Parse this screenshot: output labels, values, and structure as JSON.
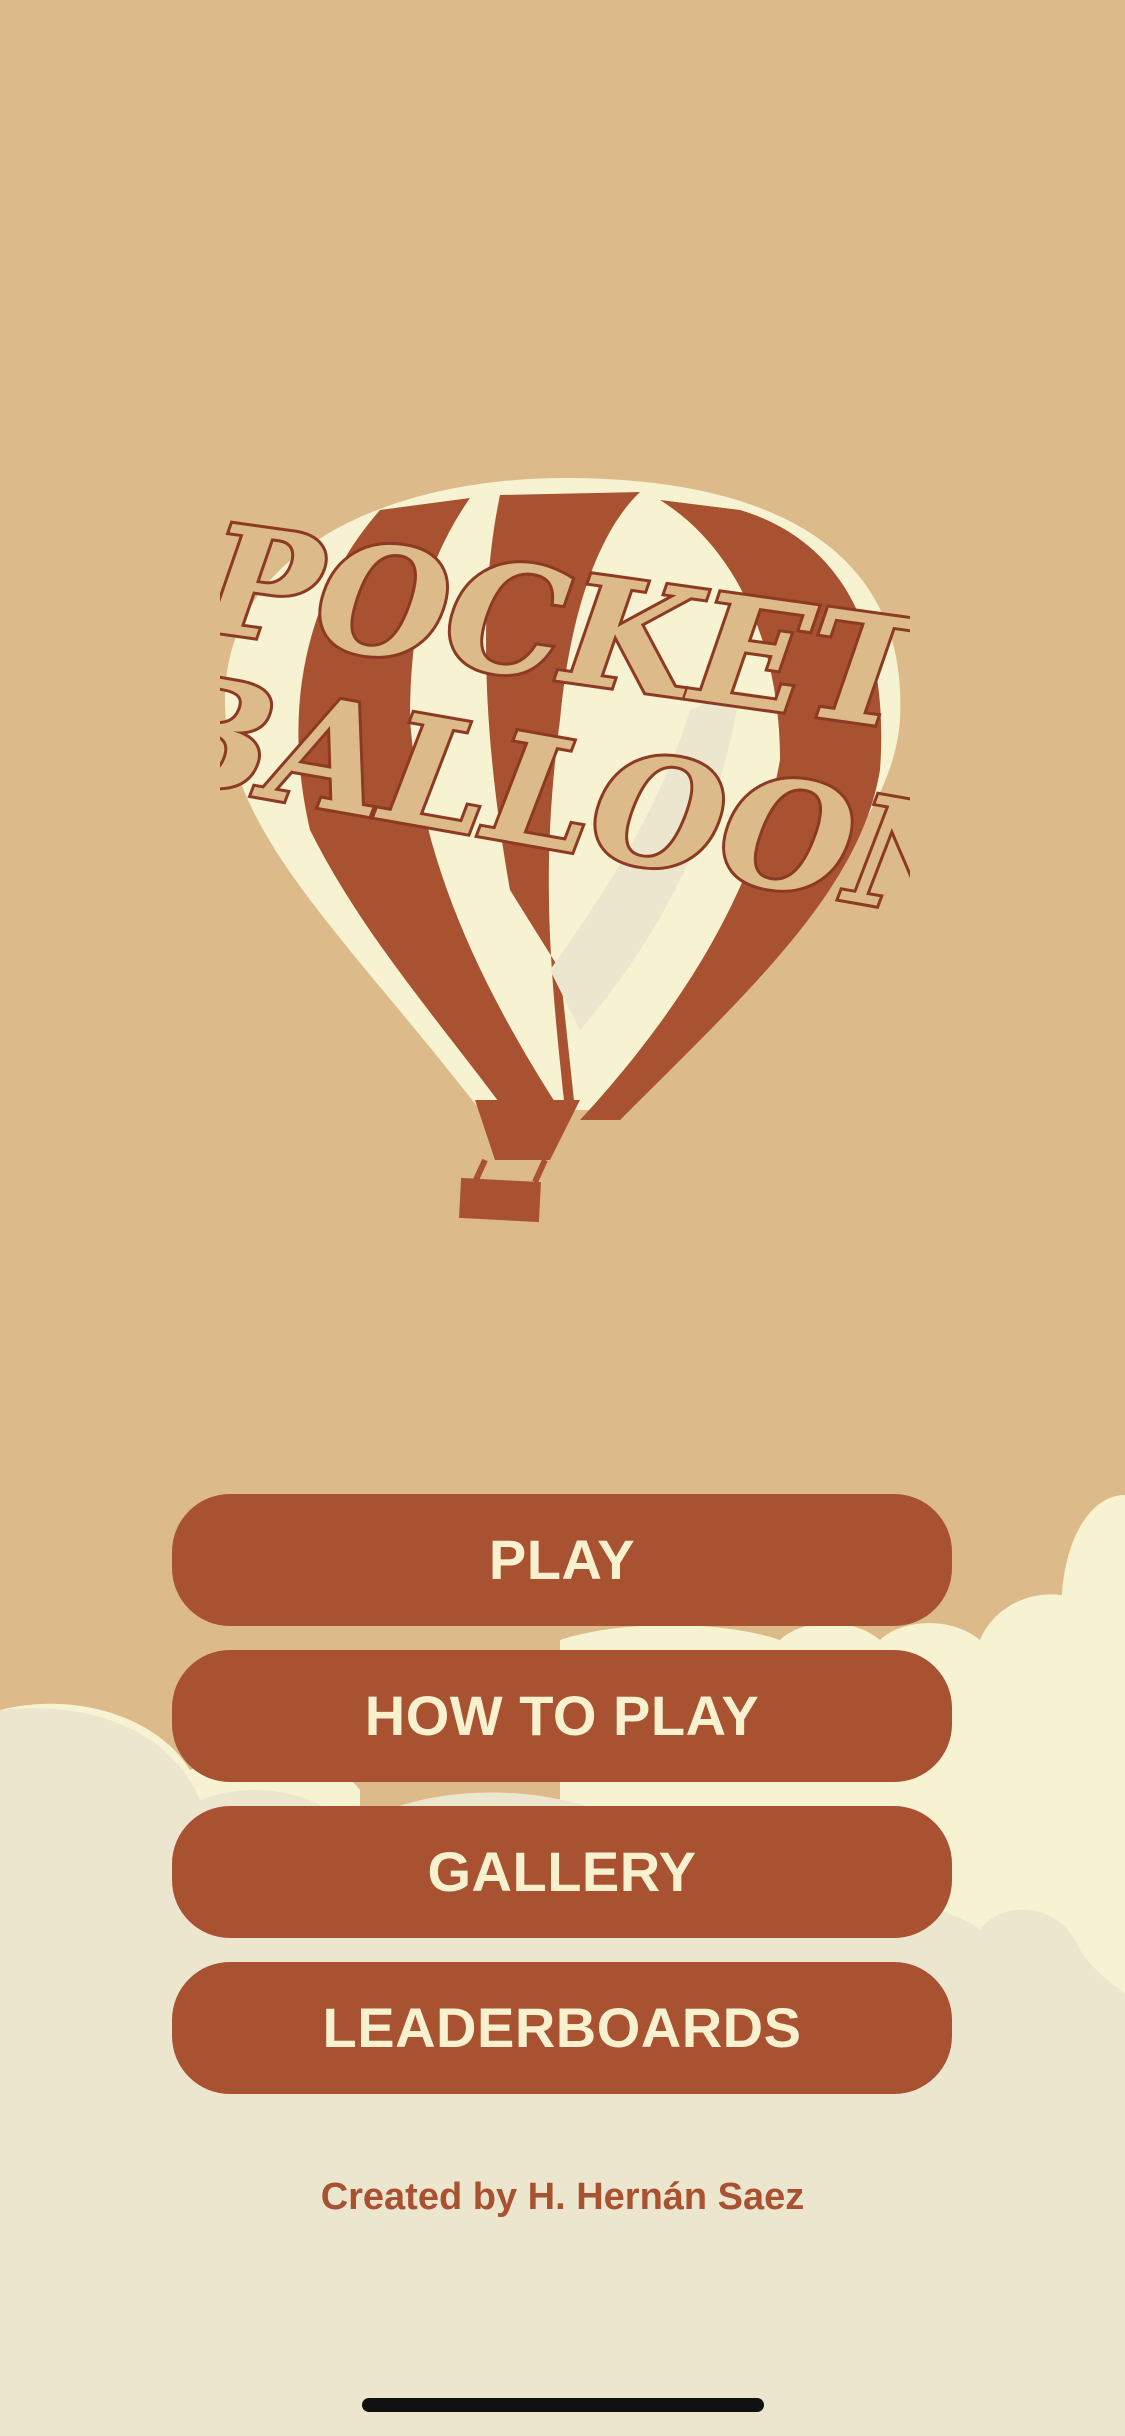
{
  "app": {
    "logo_line1": "POCKET",
    "logo_line2": "BALLOON"
  },
  "menu": {
    "play_label": "PLAY",
    "how_to_play_label": "HOW TO PLAY",
    "gallery_label": "GALLERY",
    "leaderboards_label": "LEADERBOARDS"
  },
  "footer": {
    "credit": "Created by H. Hernán Saez"
  },
  "colors": {
    "sky": "#DDBA89",
    "accent": "#A85231",
    "cloud_light": "#F7F2D2",
    "cloud_ground": "#EDE6CF",
    "button_text": "#F7F1CF"
  }
}
